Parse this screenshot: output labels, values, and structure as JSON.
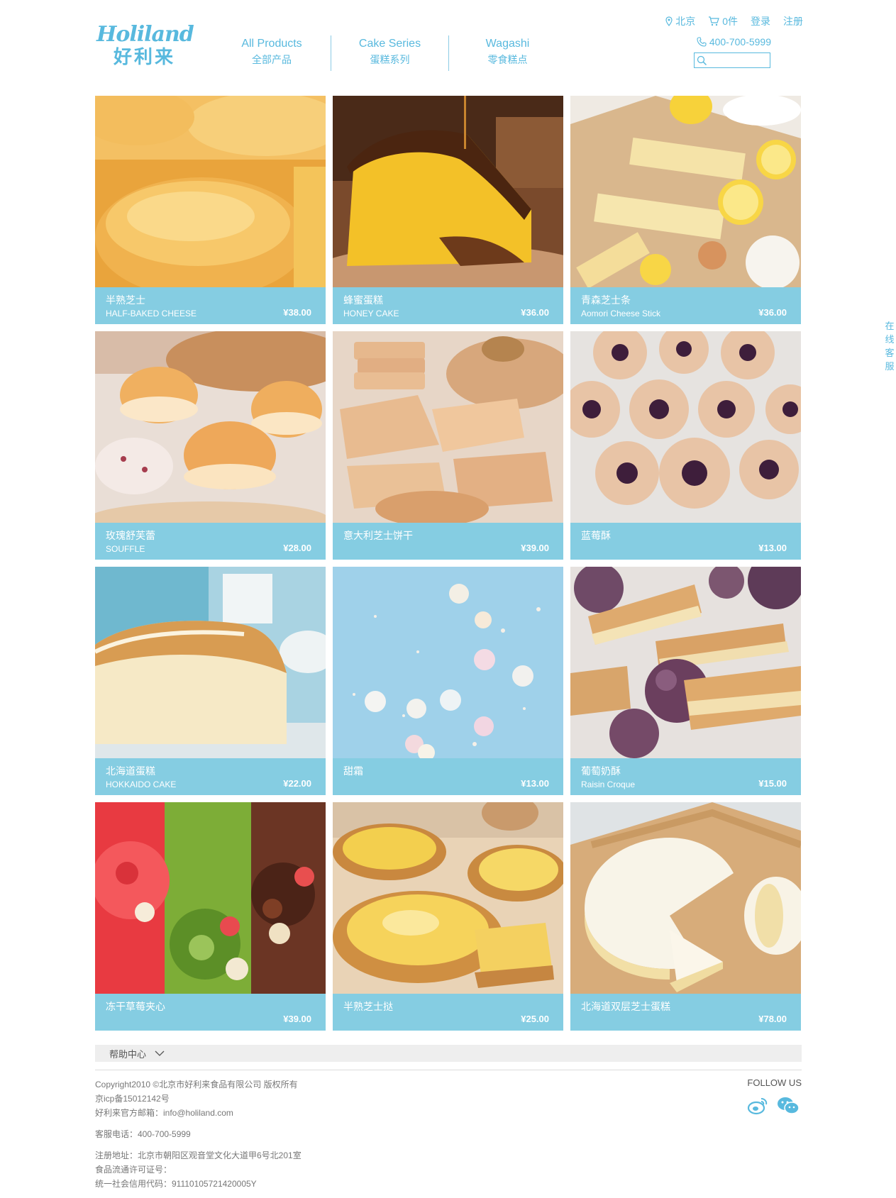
{
  "logo": {
    "en": "Holiland",
    "cn": "好利来"
  },
  "nav": [
    {
      "en": "All Products",
      "cn": "全部产品"
    },
    {
      "en": "Cake Series",
      "cn": "蛋糕系列"
    },
    {
      "en": "Wagashi",
      "cn": "零食糕点"
    }
  ],
  "top_links": {
    "city": "北京",
    "cart": "0件",
    "login": "登录",
    "register": "注册"
  },
  "phone": "400-700-5999",
  "search": {
    "placeholder": ""
  },
  "products": [
    {
      "cn": "半熟芝士",
      "en": "HALF-BAKED CHEESE",
      "price": "¥38.00",
      "image": "half-baked-cheese"
    },
    {
      "cn": "蜂蜜蛋糕",
      "en": "HONEY CAKE",
      "price": "¥36.00",
      "image": "honey-cake"
    },
    {
      "cn": "青森芝士条",
      "en": "Aomori Cheese Stick",
      "price": "¥36.00",
      "image": "cheese-stick"
    },
    {
      "cn": "玫瑰舒芙蕾",
      "en": "SOUFFLE",
      "price": "¥28.00",
      "image": "souffle"
    },
    {
      "cn": "意大利芝士饼干",
      "en": "",
      "price": "¥39.00",
      "image": "cheese-biscuit"
    },
    {
      "cn": "蓝莓酥",
      "en": "",
      "price": "¥13.00",
      "image": "blueberry-pastry"
    },
    {
      "cn": "北海道蛋糕",
      "en": "HOKKAIDO CAKE",
      "price": "¥22.00",
      "image": "hokkaido-cake"
    },
    {
      "cn": "甜霜",
      "en": "",
      "price": "¥13.00",
      "image": "meringue"
    },
    {
      "cn": "葡萄奶酥",
      "en": "Raisin Croque",
      "price": "¥15.00",
      "image": "raisin-croque"
    },
    {
      "cn": "冻干草莓夹心",
      "en": "",
      "price": "¥39.00",
      "image": "freeze-dried-strawberry"
    },
    {
      "cn": "半熟芝士挞",
      "en": "",
      "price": "¥25.00",
      "image": "cheese-tart"
    },
    {
      "cn": "北海道双层芝士蛋糕",
      "en": "",
      "price": "¥78.00",
      "image": "double-cheesecake"
    }
  ],
  "side_service": [
    "在",
    "线",
    "客",
    "服"
  ],
  "footer": {
    "help": "帮助中心",
    "copyright": "Copyright2010 ©北京市好利来食品有限公司 版权所有",
    "icp": "京icp备15012142号",
    "email": "好利来官方邮箱：info@holiland.com",
    "service_phone": "客服电话：400-700-5999",
    "address": "注册地址：北京市朝阳区观音堂文化大道甲6号北201室",
    "license": "食品流通许可证号：",
    "credit_code": "统一社会信用代码：91110105721420005Y",
    "follow": "FOLLOW US"
  },
  "colors": {
    "accent": "#58b9de",
    "card_bar": "#85cde2"
  }
}
